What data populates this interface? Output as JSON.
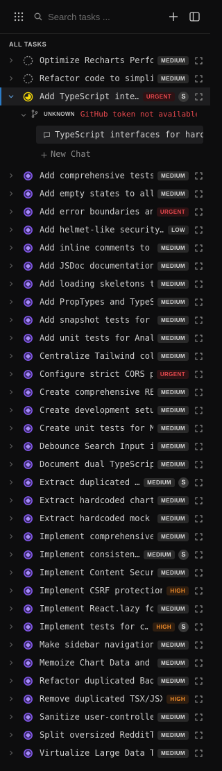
{
  "search": {
    "placeholder": "Search tasks ..."
  },
  "section": {
    "title": "ALL TASKS"
  },
  "colors": {
    "accent": "#2b7cc7",
    "in_progress_icon": "#f5d90a",
    "done_icon": "#8b5cf6",
    "urgent": "#e5484d",
    "high": "#f08c2a"
  },
  "top_tasks": [
    {
      "title": "Optimize Recharts Perfo…",
      "priority": "MEDIUM",
      "status": "todo"
    },
    {
      "title": "Refactor code to simpli…",
      "priority": "MEDIUM",
      "status": "todo"
    }
  ],
  "active_task": {
    "title": "Add TypeScript inte…",
    "priority": "URGENT",
    "assignee": "S",
    "status": "in-progress",
    "subtask": {
      "label": "UNKNOWN",
      "error": "GitHub token not available for t…"
    },
    "chat": {
      "title": "TypeScript interfaces for hardc…"
    },
    "new_chat_label": "New Chat"
  },
  "tasks": [
    {
      "title": "Add comprehensive tests…",
      "priority": "MEDIUM",
      "assignee": ""
    },
    {
      "title": "Add empty states to all…",
      "priority": "MEDIUM",
      "assignee": ""
    },
    {
      "title": "Add error boundaries an…",
      "priority": "URGENT",
      "assignee": ""
    },
    {
      "title": "Add helmet-like security…",
      "priority": "LOW",
      "assignee": ""
    },
    {
      "title": "Add inline comments to …",
      "priority": "MEDIUM",
      "assignee": ""
    },
    {
      "title": "Add JSDoc documentation…",
      "priority": "MEDIUM",
      "assignee": ""
    },
    {
      "title": "Add loading skeletons t…",
      "priority": "MEDIUM",
      "assignee": ""
    },
    {
      "title": "Add PropTypes and TypeS…",
      "priority": "MEDIUM",
      "assignee": ""
    },
    {
      "title": "Add snapshot tests for …",
      "priority": "MEDIUM",
      "assignee": ""
    },
    {
      "title": "Add unit tests for Anal…",
      "priority": "MEDIUM",
      "assignee": ""
    },
    {
      "title": "Centralize Tailwind col…",
      "priority": "MEDIUM",
      "assignee": ""
    },
    {
      "title": "Configure strict CORS p…",
      "priority": "URGENT",
      "assignee": ""
    },
    {
      "title": "Create comprehensive RE…",
      "priority": "MEDIUM",
      "assignee": ""
    },
    {
      "title": "Create development setu…",
      "priority": "MEDIUM",
      "assignee": ""
    },
    {
      "title": "Create unit tests for M…",
      "priority": "MEDIUM",
      "assignee": ""
    },
    {
      "title": "Debounce Search Input i…",
      "priority": "MEDIUM",
      "assignee": ""
    },
    {
      "title": "Document dual TypeScrip…",
      "priority": "MEDIUM",
      "assignee": ""
    },
    {
      "title": "Extract duplicated …",
      "priority": "MEDIUM",
      "assignee": "S"
    },
    {
      "title": "Extract hardcoded chart…",
      "priority": "MEDIUM",
      "assignee": ""
    },
    {
      "title": "Extract hardcoded mock …",
      "priority": "MEDIUM",
      "assignee": ""
    },
    {
      "title": "Implement comprehensive…",
      "priority": "MEDIUM",
      "assignee": ""
    },
    {
      "title": "Implement consisten…",
      "priority": "MEDIUM",
      "assignee": "S"
    },
    {
      "title": "Implement Content Secur…",
      "priority": "MEDIUM",
      "assignee": ""
    },
    {
      "title": "Implement CSRF protection…",
      "priority": "HIGH",
      "assignee": ""
    },
    {
      "title": "Implement React.lazy fo…",
      "priority": "MEDIUM",
      "assignee": ""
    },
    {
      "title": "Implement tests for c…",
      "priority": "HIGH",
      "assignee": "S"
    },
    {
      "title": "Make sidebar navigation…",
      "priority": "MEDIUM",
      "assignee": ""
    },
    {
      "title": "Memoize Chart Data and …",
      "priority": "MEDIUM",
      "assignee": ""
    },
    {
      "title": "Refactor duplicated Bad…",
      "priority": "MEDIUM",
      "assignee": ""
    },
    {
      "title": "Remove duplicated TSX/JSX…",
      "priority": "HIGH",
      "assignee": ""
    },
    {
      "title": "Sanitize user-controlle…",
      "priority": "MEDIUM",
      "assignee": ""
    },
    {
      "title": "Split oversized RedditT…",
      "priority": "MEDIUM",
      "assignee": ""
    },
    {
      "title": "Virtualize Large Data T…",
      "priority": "MEDIUM",
      "assignee": ""
    }
  ]
}
